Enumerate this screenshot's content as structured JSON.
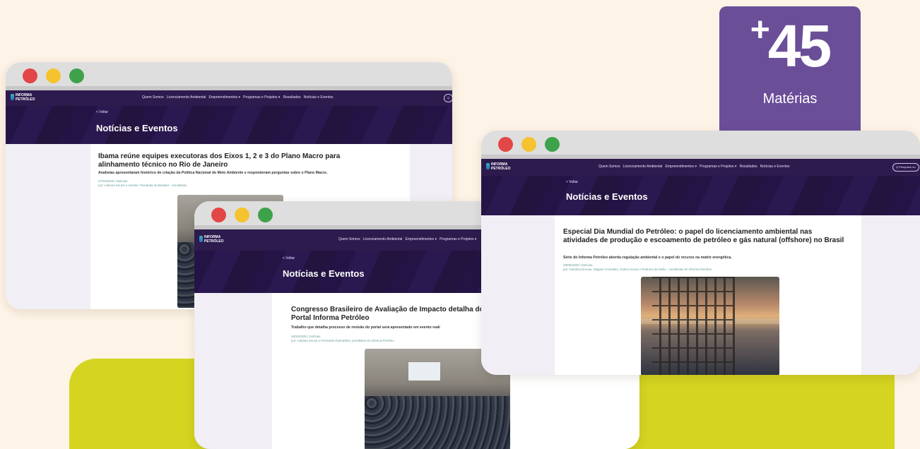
{
  "badge": {
    "plus": "+",
    "number": "45",
    "label": "Matérias"
  },
  "site": {
    "logo_line1": "INFORMA",
    "logo_line2": "PETRÓLEO",
    "nav": [
      "Quem Somos",
      "Licenciamento Ambiental",
      "Empreendimentos ▾",
      "Programas e Projetos ▾",
      "Resultados",
      "Notícias e Eventos"
    ],
    "search_placeholder": "Q  Pesquisar no",
    "back": "< Voltar",
    "page_title": "Notícias e Eventos"
  },
  "windows": [
    {
      "article_title": "Ibama reúne equipes executoras dos Eixos 1, 2 e 3 do Plano Macro para alinhamento técnico no Rio de Janeiro",
      "article_subtitle": "Analistas apresentaram histórico de criação da Política Nacional do Meio Ambiente e responderam perguntas sobre o Plano Macro.",
      "meta_date": "27/10/2025 | Notícias",
      "meta_author": "por: Adriana Souza e revisão: Fernanda Guimarães - Jornalistas"
    },
    {
      "article_title": "Congresso Brasileiro de Avaliação de Impacto detalha do Portal Informa Petróleo",
      "article_subtitle": "Trabalho que detalha processo de revisão do portal será apresentado em evento reali",
      "meta_date": "18/10/2025 | Notícias",
      "meta_author": "por: Adriana Souza e Fernanda Guimarães, jornalistas do Informa Petróleo"
    },
    {
      "article_title": "Especial Dia Mundial do Petróleo: o papel do licenciamento ambiental nas atividades de produção e escoamento de petróleo e gás natural (offshore) no Brasil",
      "article_subtitle": "Série do Informa Petróleo aborda regulação ambiental e o papel do recurso na matriz energética.",
      "meta_date": "29/09/2025 | Notícias",
      "meta_author": "por: Karolina Dornas, Wagner Gonzales, Carlos Souza e Pedroca de Mello - Jornalistas do Informa Petróleo"
    }
  ],
  "colors": {
    "background": "#fdf3e6",
    "lime": "#d4d421",
    "badge": "#6b4e98",
    "nav": "#2d1b4e"
  },
  "icons": [
    "close-dot-icon",
    "minimize-dot-icon",
    "maximize-dot-icon",
    "logo-icon",
    "search-icon"
  ]
}
